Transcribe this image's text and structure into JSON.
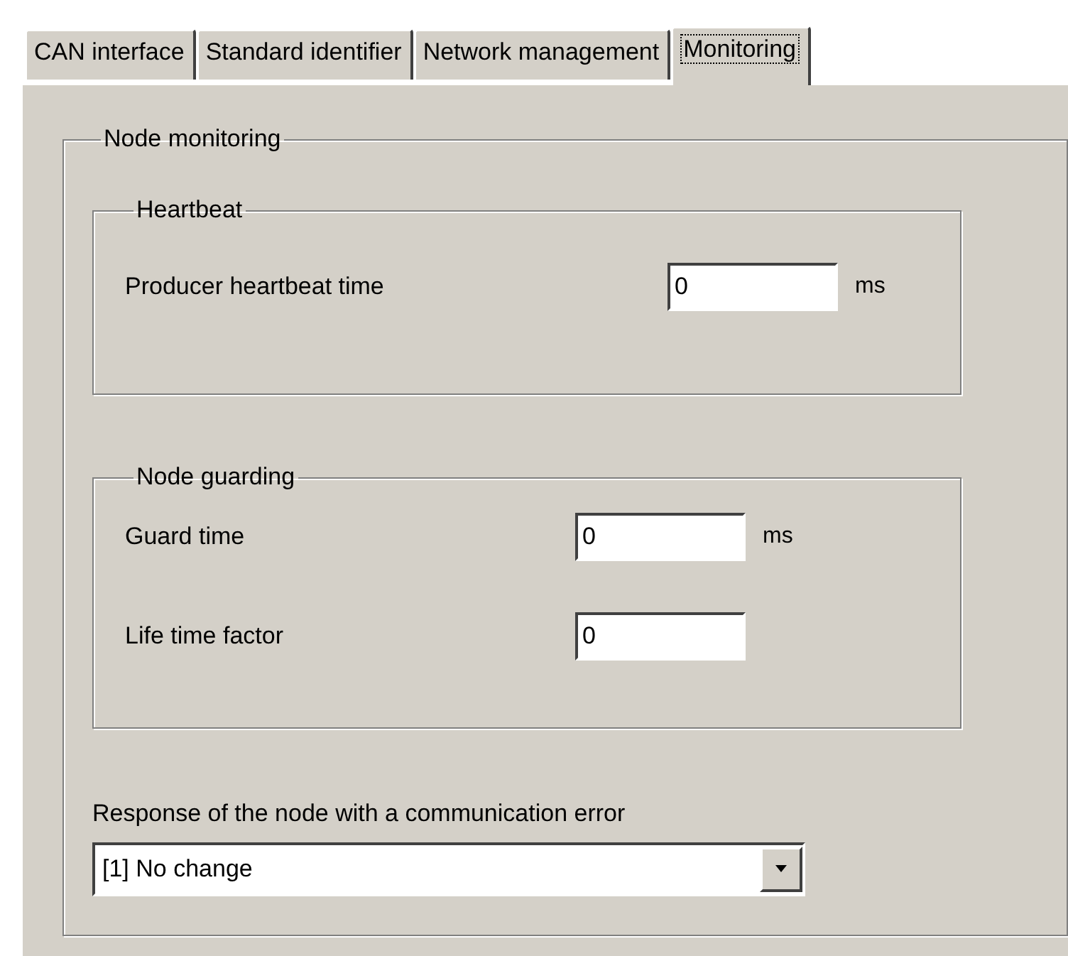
{
  "tabs": [
    {
      "label": "CAN interface",
      "selected": false
    },
    {
      "label": "Standard identifier",
      "selected": false
    },
    {
      "label": "Network management",
      "selected": false
    },
    {
      "label": "Monitoring",
      "selected": true
    }
  ],
  "node_monitoring": {
    "title": "Node monitoring",
    "heartbeat": {
      "title": "Heartbeat",
      "fields": [
        {
          "label": "Producer heartbeat time",
          "value": "0",
          "unit": "ms"
        }
      ]
    },
    "node_guarding": {
      "title": "Node guarding",
      "fields": [
        {
          "label": "Guard time",
          "value": "0",
          "unit": "ms"
        },
        {
          "label": "Life time factor",
          "value": "0"
        }
      ]
    },
    "response": {
      "label": "Response of the node with a communication error",
      "value": "[1] No change"
    }
  }
}
